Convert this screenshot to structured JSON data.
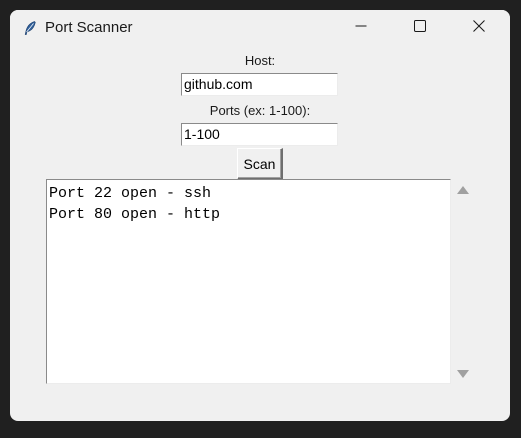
{
  "window": {
    "title": "Port Scanner",
    "background": "#f0f0f0"
  },
  "titlebar_icons": {
    "app": "feather-icon",
    "minimize": "minimize-icon",
    "maximize": "maximize-icon",
    "close": "close-icon"
  },
  "form": {
    "host_label": "Host:",
    "host_value": "github.com",
    "ports_label": "Ports (ex: 1-100):",
    "ports_value": "1-100",
    "scan_label": "Scan"
  },
  "output": {
    "lines": [
      "Port 22 open - ssh",
      "Port 80 open - http"
    ]
  }
}
